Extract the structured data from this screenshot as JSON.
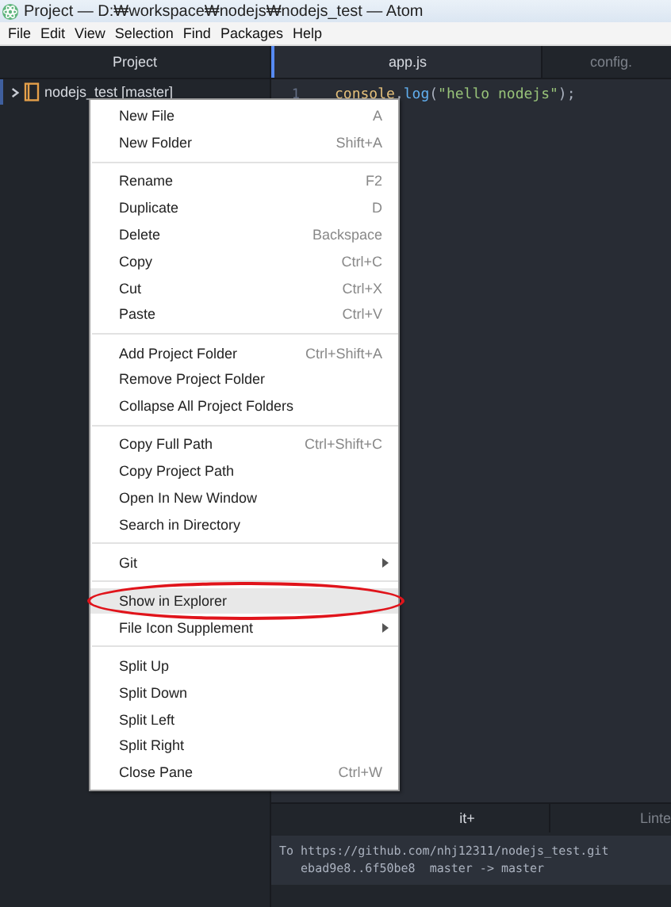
{
  "window": {
    "title": "Project — D:₩workspace₩nodejs₩nodejs_test — Atom"
  },
  "menu_bar": [
    "File",
    "Edit",
    "View",
    "Selection",
    "Find",
    "Packages",
    "Help"
  ],
  "tree_view": {
    "title": "Project",
    "root": {
      "label": "nodejs_test [master]",
      "expanded": false
    }
  },
  "editor_tabs": [
    {
      "label": "app.js",
      "selected": true
    },
    {
      "label": "config.",
      "selected": false
    }
  ],
  "editor": {
    "lines": [
      {
        "number": "1",
        "tokens": [
          {
            "kind": "object",
            "text": "console"
          },
          {
            "kind": "punct",
            "text": "."
          },
          {
            "kind": "function",
            "text": "log"
          },
          {
            "kind": "punct",
            "text": "("
          },
          {
            "kind": "string",
            "text": "\"hello nodejs\""
          },
          {
            "kind": "punct",
            "text": ");"
          }
        ]
      }
    ]
  },
  "context_menu": {
    "sections": [
      [
        {
          "label": "New File",
          "shortcut": "A",
          "submenu": false,
          "selected": false,
          "circled": false
        },
        {
          "label": "New Folder",
          "shortcut": "Shift+A",
          "submenu": false,
          "selected": false,
          "circled": false
        }
      ],
      [
        {
          "label": "Rename",
          "shortcut": "F2",
          "submenu": false,
          "selected": false,
          "circled": false
        },
        {
          "label": "Duplicate",
          "shortcut": "D",
          "submenu": false,
          "selected": false,
          "circled": false
        },
        {
          "label": "Delete",
          "shortcut": "Backspace",
          "submenu": false,
          "selected": false,
          "circled": false
        },
        {
          "label": "Copy",
          "shortcut": "Ctrl+C",
          "submenu": false,
          "selected": false,
          "circled": false
        },
        {
          "label": "Cut",
          "shortcut": "Ctrl+X",
          "submenu": false,
          "selected": false,
          "circled": false
        },
        {
          "label": "Paste",
          "shortcut": "Ctrl+V",
          "submenu": false,
          "selected": false,
          "circled": false
        }
      ],
      [
        {
          "label": "Add Project Folder",
          "shortcut": "Ctrl+Shift+A",
          "submenu": false,
          "selected": false,
          "circled": false
        },
        {
          "label": "Remove Project Folder",
          "submenu": false,
          "selected": false,
          "circled": false
        },
        {
          "label": "Collapse All Project Folders",
          "submenu": false,
          "selected": false,
          "circled": false
        }
      ],
      [
        {
          "label": "Copy Full Path",
          "shortcut": "Ctrl+Shift+C",
          "submenu": false,
          "selected": false,
          "circled": false
        },
        {
          "label": "Copy Project Path",
          "submenu": false,
          "selected": false,
          "circled": false
        },
        {
          "label": "Open In New Window",
          "submenu": false,
          "selected": false,
          "circled": false
        },
        {
          "label": "Search in Directory",
          "submenu": false,
          "selected": false,
          "circled": false
        }
      ],
      [
        {
          "label": "Git",
          "submenu": true,
          "selected": false,
          "circled": false
        }
      ],
      [
        {
          "label": "Show in Explorer",
          "submenu": false,
          "selected": true,
          "circled": true
        },
        {
          "label": "File Icon Supplement",
          "submenu": true,
          "selected": false,
          "circled": false
        }
      ],
      [
        {
          "label": "Split Up",
          "submenu": false,
          "selected": false,
          "circled": false
        },
        {
          "label": "Split Down",
          "submenu": false,
          "selected": false,
          "circled": false
        },
        {
          "label": "Split Left",
          "submenu": false,
          "selected": false,
          "circled": false
        },
        {
          "label": "Split Right",
          "submenu": false,
          "selected": false,
          "circled": false
        },
        {
          "label": "Close Pane",
          "shortcut": "Ctrl+W",
          "submenu": false,
          "selected": false,
          "circled": false
        }
      ]
    ]
  },
  "bottom_panel": {
    "tabs": [
      {
        "label": "it+"
      },
      {
        "label": "Linte"
      }
    ],
    "output": [
      "To https://github.com/nhj12311/nodejs_test.git",
      "   ebad9e8..6f50be8  master -> master"
    ]
  }
}
